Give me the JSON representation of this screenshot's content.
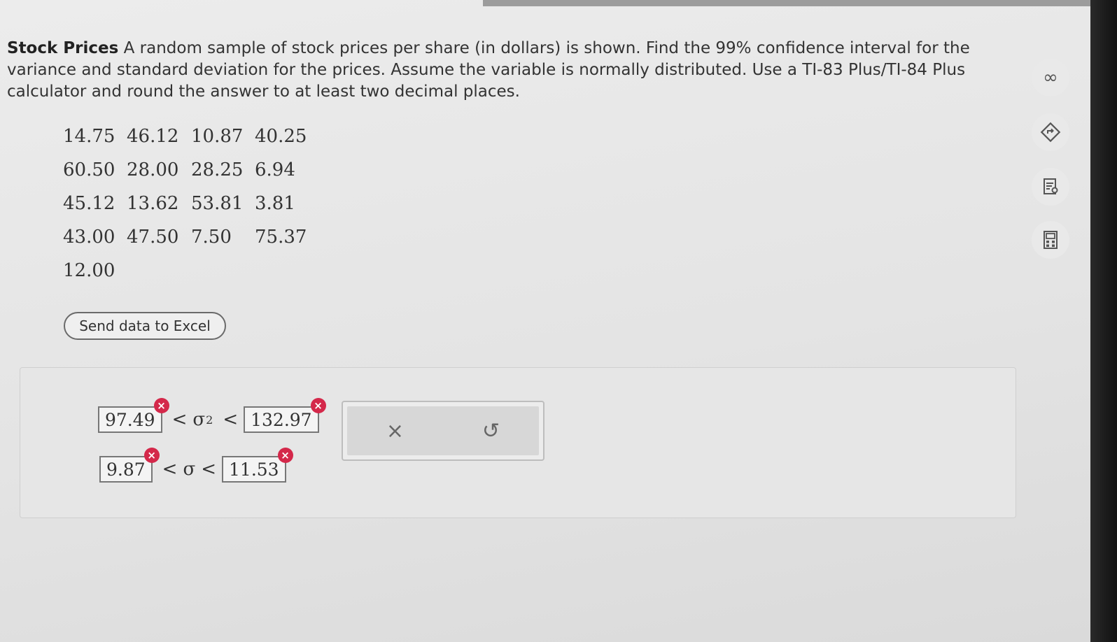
{
  "problem": {
    "title": "Stock Prices",
    "text": "A random sample of stock prices per share (in dollars) is shown. Find the 99% confidence interval for the variance and standard deviation for the prices. Assume the variable is normally distributed. Use a TI-83 Plus/TI-84 Plus calculator and round the answer to at least two decimal places."
  },
  "data_values": [
    "14.75",
    "46.12",
    "10.87",
    "40.25",
    "60.50",
    "28.00",
    "28.25",
    "6.94",
    "45.12",
    "13.62",
    "53.81",
    "3.81",
    "43.00",
    "47.50",
    "7.50",
    "75.37",
    "12.00"
  ],
  "excel_button": "Send data to Excel",
  "answers": {
    "variance_lower": "97.49",
    "variance_upper": "132.97",
    "sd_lower": "9.87",
    "sd_upper": "11.53",
    "sigma": "σ",
    "sigma_exp": "2",
    "less_than": "<"
  },
  "error_mark": "×",
  "actions": {
    "clear_symbol": "×",
    "undo_symbol": "↺"
  },
  "tools": {
    "infinity": "∞",
    "colors": {
      "error": "#d4284a"
    }
  }
}
